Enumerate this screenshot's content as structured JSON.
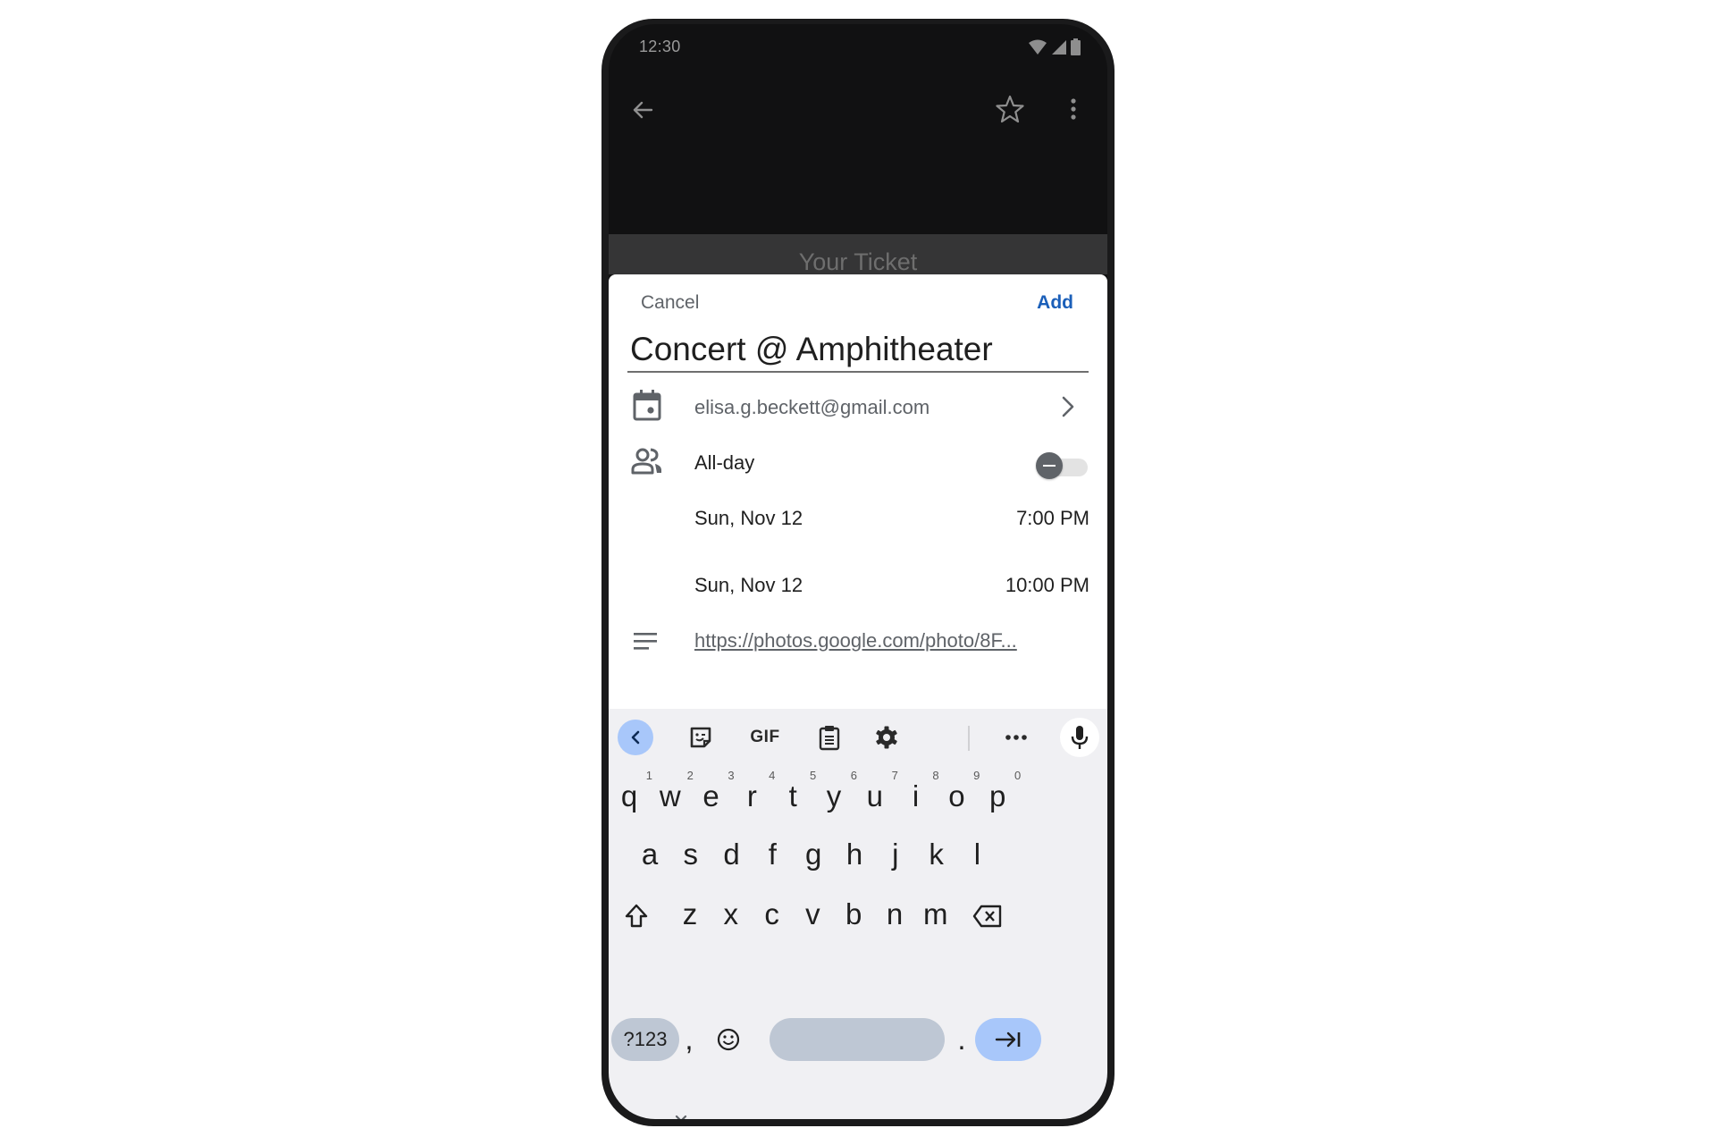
{
  "status_bar": {
    "time": "12:30",
    "icons": [
      "wifi-icon",
      "signal-icon",
      "battery-icon"
    ]
  },
  "app_bar": {
    "back": "back-arrow-icon",
    "actions": [
      "star-icon",
      "more-vert-icon"
    ]
  },
  "background_page": {
    "title": "Your Ticket"
  },
  "event_sheet": {
    "cancel_label": "Cancel",
    "add_label": "Add",
    "title_value": "Concert @ Amphitheater",
    "account": "elisa.g.beckett@gmail.com",
    "all_day_label": "All-day",
    "all_day_on": false,
    "start_date": "Sun, Nov 12",
    "start_time": "7:00 PM",
    "end_date": "Sun, Nov 12",
    "end_time": "10:00 PM",
    "description_link": "https://photos.google.com/photo/8F..."
  },
  "keyboard": {
    "toolbar": {
      "gif_label": "GIF",
      "items": [
        "collapse-toolbar",
        "sticker",
        "gif",
        "clipboard",
        "settings",
        "more",
        "voice-input"
      ]
    },
    "row1": [
      {
        "key": "q",
        "hint": "1"
      },
      {
        "key": "w",
        "hint": "2"
      },
      {
        "key": "e",
        "hint": "3"
      },
      {
        "key": "r",
        "hint": "4"
      },
      {
        "key": "t",
        "hint": "5"
      },
      {
        "key": "y",
        "hint": "6"
      },
      {
        "key": "u",
        "hint": "7"
      },
      {
        "key": "i",
        "hint": "8"
      },
      {
        "key": "o",
        "hint": "9"
      },
      {
        "key": "p",
        "hint": "0"
      }
    ],
    "row2": [
      "a",
      "s",
      "d",
      "f",
      "g",
      "h",
      "j",
      "k",
      "l"
    ],
    "row3": [
      "z",
      "x",
      "c",
      "v",
      "b",
      "n",
      "m"
    ],
    "symbols_label": "?123",
    "comma": ",",
    "period": ".",
    "colors": {
      "background": "#f0f0f3",
      "accent_key": "#a8c7fa",
      "function_key": "#bec7d4"
    }
  },
  "colors": {
    "add_button": "#1b5fb9",
    "secondary_text": "#5f6368"
  }
}
